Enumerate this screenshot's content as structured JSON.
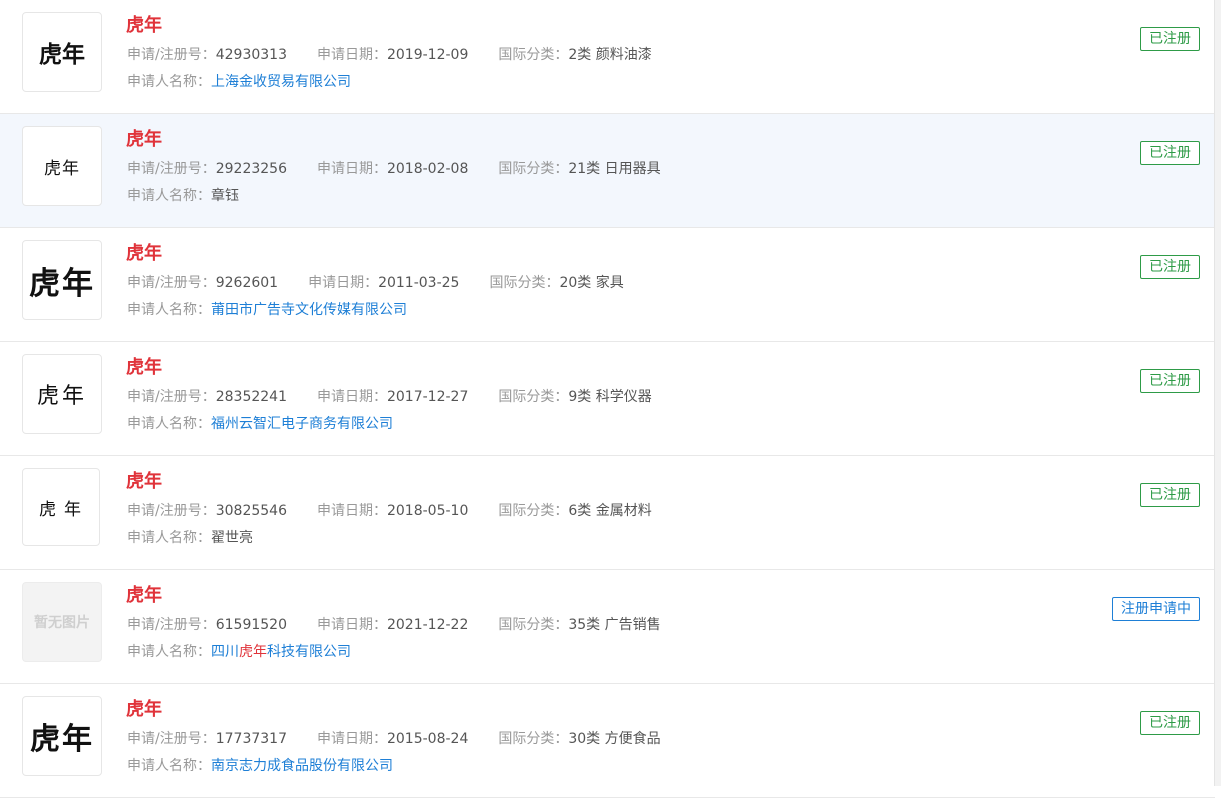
{
  "labels": {
    "reg_no": "申请/注册号：",
    "app_date": "申请日期：",
    "intl_class": "国际分类：",
    "applicant": "申请人名称："
  },
  "items": [
    {
      "logo_text": "虎年",
      "title": "虎年",
      "reg_no": "42930313",
      "app_date": "2019-12-09",
      "intl_class": "2类 颜料油漆",
      "applicant": "上海金收贸易有限公司",
      "applicant_linked": true,
      "status": "已注册",
      "status_type": "registered"
    },
    {
      "logo_text": "虎年",
      "title": "虎年",
      "reg_no": "29223256",
      "app_date": "2018-02-08",
      "intl_class": "21类 日用器具",
      "applicant": "章钰",
      "applicant_linked": false,
      "status": "已注册",
      "status_type": "registered"
    },
    {
      "logo_text": "虎年",
      "title": "虎年",
      "reg_no": "9262601",
      "app_date": "2011-03-25",
      "intl_class": "20类 家具",
      "applicant": "莆田市广告寺文化传媒有限公司",
      "applicant_linked": true,
      "status": "已注册",
      "status_type": "registered"
    },
    {
      "logo_text": "虎年",
      "title": "虎年",
      "reg_no": "28352241",
      "app_date": "2017-12-27",
      "intl_class": "9类 科学仪器",
      "applicant": "福州云智汇电子商务有限公司",
      "applicant_linked": true,
      "status": "已注册",
      "status_type": "registered"
    },
    {
      "logo_text": "虎年",
      "title": "虎年",
      "reg_no": "30825546",
      "app_date": "2018-05-10",
      "intl_class": "6类 金属材料",
      "applicant": "翟世亮",
      "applicant_linked": false,
      "status": "已注册",
      "status_type": "registered"
    },
    {
      "logo_text": "暂无图片",
      "title": "虎年",
      "reg_no": "61591520",
      "app_date": "2021-12-22",
      "intl_class": "35类 广告销售",
      "applicant_prefix": "四川",
      "applicant_em": "虎年",
      "applicant_suffix": "科技有限公司",
      "applicant_linked": true,
      "status": "注册申请中",
      "status_type": "pending"
    },
    {
      "logo_text": "虎年",
      "title": "虎年",
      "reg_no": "17737317",
      "app_date": "2015-08-24",
      "intl_class": "30类 方便食品",
      "applicant": "南京志力成食品股份有限公司",
      "applicant_linked": true,
      "status": "已注册",
      "status_type": "registered"
    }
  ],
  "colors": {
    "title_red": "#e0333a",
    "link_blue": "#1e7fd6",
    "registered_green": "#2e9b47",
    "highlight_row": "#f3f7fd"
  }
}
